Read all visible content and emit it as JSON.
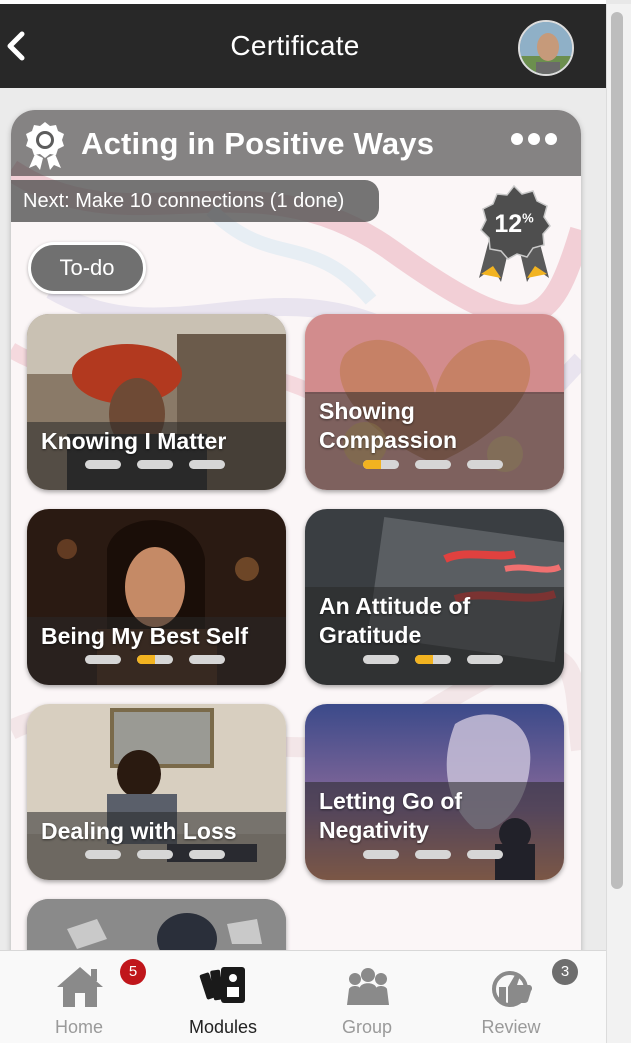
{
  "header": {
    "title": "Certificate"
  },
  "certificate": {
    "title": "Acting in Positive Ways",
    "next_text": "Next: Make 10 connections (1 done)",
    "progress_label": "12",
    "progress_suffix": "%",
    "progress_percent": 12,
    "todo_label": "To-do"
  },
  "modules": [
    {
      "label_lines": [
        "Knowing I Matter"
      ],
      "progress": [
        0,
        0,
        0
      ]
    },
    {
      "label_lines": [
        "Showing",
        "Compassion"
      ],
      "progress": [
        0.5,
        0,
        0
      ]
    },
    {
      "label_lines": [
        "Being My Best Self"
      ],
      "progress": [
        0,
        0.5,
        0
      ]
    },
    {
      "label_lines": [
        "An Attitude of",
        "Gratitude"
      ],
      "progress": [
        0,
        0.5,
        0
      ]
    },
    {
      "label_lines": [
        "Dealing with Loss"
      ],
      "progress": [
        0,
        0,
        0
      ]
    },
    {
      "label_lines": [
        "Letting Go of",
        "Negativity"
      ],
      "progress": [
        0,
        0,
        0
      ]
    }
  ],
  "nav": {
    "home": {
      "label": "Home",
      "badge": "5",
      "badge_color": "#c0161b"
    },
    "modules": {
      "label": "Modules"
    },
    "group": {
      "label": "Group"
    },
    "review": {
      "label": "Review",
      "badge": "3",
      "badge_color": "#6e6e6e"
    }
  },
  "colors": {
    "progress_fill": "#f2b320",
    "header_bg": "#282828"
  }
}
